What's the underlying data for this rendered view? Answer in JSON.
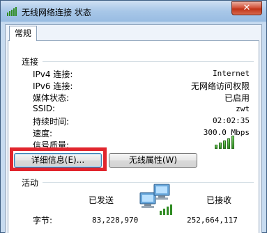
{
  "window": {
    "title": "无线网络连接 状态",
    "close_label": "✕"
  },
  "tabs": [
    {
      "label": "常规"
    }
  ],
  "connection": {
    "group_label": "连接",
    "rows": [
      {
        "label": "IPv4 连接:",
        "value": "Internet"
      },
      {
        "label": "IPv6 连接:",
        "value": "无网络访问权限"
      },
      {
        "label": "媒体状态:",
        "value": "已启用"
      },
      {
        "label": "SSID:",
        "value": "zwt"
      },
      {
        "label": "持续时间:",
        "value": "02:02:35"
      },
      {
        "label": "速度:",
        "value": "300.0 Mbps"
      }
    ],
    "signal_label": "信号质量:",
    "signal_bars": 5
  },
  "buttons": {
    "details": "详细信息(E)...",
    "wireless_props": "无线属性(W)"
  },
  "activity": {
    "group_label": "活动",
    "sent_label": "已发送",
    "received_label": "已接收",
    "bytes_label": "字节:",
    "bytes_sent": "83,228,970",
    "bytes_received": "252,664,117"
  },
  "colors": {
    "highlight": "#e1252d",
    "signal": "#2f8b22"
  }
}
